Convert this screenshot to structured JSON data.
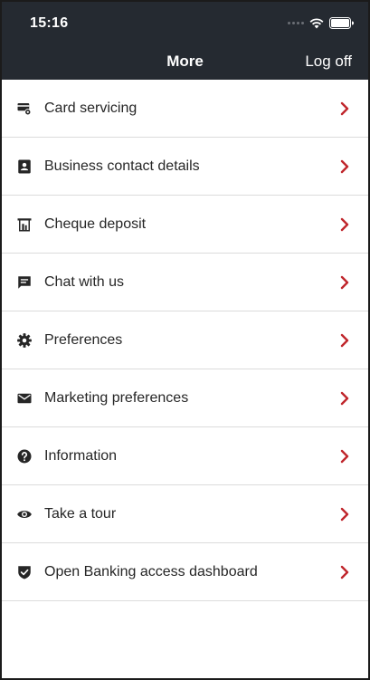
{
  "status": {
    "time": "15:16"
  },
  "header": {
    "title": "More",
    "logoff_label": "Log off"
  },
  "colors": {
    "topbar": "#252a31",
    "chevron": "#c0262c",
    "text": "#262626",
    "divider": "#dcdcdc"
  },
  "menu": [
    {
      "label": "Card servicing",
      "icon": "card-settings-icon"
    },
    {
      "label": "Business contact details",
      "icon": "contact-card-icon"
    },
    {
      "label": "Cheque deposit",
      "icon": "cheque-deposit-icon"
    },
    {
      "label": "Chat with us",
      "icon": "chat-bubble-icon"
    },
    {
      "label": "Preferences",
      "icon": "gear-icon"
    },
    {
      "label": "Marketing preferences",
      "icon": "envelope-icon"
    },
    {
      "label": "Information",
      "icon": "question-circle-icon"
    },
    {
      "label": "Take a tour",
      "icon": "eye-icon"
    },
    {
      "label": "Open Banking access dashboard",
      "icon": "shield-check-icon"
    }
  ]
}
